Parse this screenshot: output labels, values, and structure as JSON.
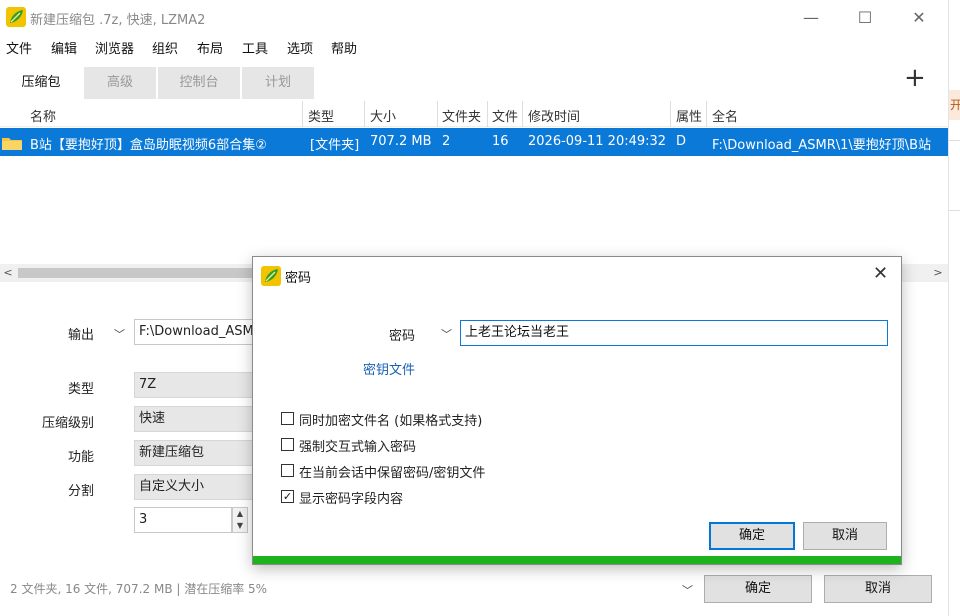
{
  "window": {
    "title": "新建压缩包 .7z, 快速, LZMA2",
    "controls": {
      "minimize": "—",
      "maximize": "☐",
      "close": "✕"
    }
  },
  "menu": [
    "文件",
    "编辑",
    "浏览器",
    "组织",
    "布局",
    "工具",
    "选项",
    "帮助"
  ],
  "tabs": [
    {
      "label": "压缩包",
      "active": true
    },
    {
      "label": "高级",
      "active": false
    },
    {
      "label": "控制台",
      "active": false
    },
    {
      "label": "计划",
      "active": false
    }
  ],
  "add_tab_glyph": "+",
  "list": {
    "columns": [
      "名称",
      "类型",
      "大小",
      "文件夹",
      "文件",
      "修改时间",
      "属性",
      "全名"
    ],
    "rows": [
      {
        "name": "B站【要抱好顶】盒岛助眠视频6部合集②",
        "type": "[文件夹]",
        "size": "707.2 MB",
        "folders": "2",
        "files": "16",
        "modified": "2026-09-11 20:49:32",
        "attr": "D",
        "fullname": "F:\\Download_ASMR\\1\\要抱好顶\\B站"
      }
    ]
  },
  "scroll": {
    "left": "<",
    "right": ">"
  },
  "options": {
    "output_label": "输出",
    "output_value": "F:\\Download_ASM",
    "type_label": "类型",
    "type_value": "7Z",
    "level_label": "压缩级别",
    "level_value": "快速",
    "function_label": "功能",
    "function_value": "新建压缩包",
    "split_label": "分割",
    "split_value": "自定义大小",
    "split_number": "3"
  },
  "status": "2 文件夹,  16 文件,  707.2 MB | 潜在压缩率 5%",
  "main_buttons": {
    "ok": "确定",
    "cancel": "取消"
  },
  "bg_window_glyph": "开",
  "dialog": {
    "title": "密码",
    "close": "✕",
    "password_label": "密码",
    "password_value": "上老王论坛当老王",
    "keyfile_link": "密钥文件",
    "checkboxes": [
      {
        "label": "同时加密文件名 (如果格式支持)",
        "checked": false
      },
      {
        "label": "强制交互式输入密码",
        "checked": false
      },
      {
        "label": "在当前会话中保留密码/密钥文件",
        "checked": false
      },
      {
        "label": "显示密码字段内容",
        "checked": true
      }
    ],
    "ok": "确定",
    "cancel": "取消",
    "progress_color": "#1db31d"
  },
  "colors": {
    "selection": "#0a79d8",
    "link": "#1a5fb4",
    "accent": "#0078d7"
  }
}
